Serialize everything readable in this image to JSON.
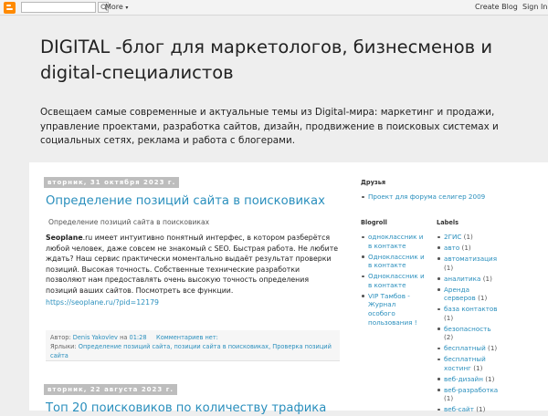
{
  "navbar": {
    "logo_icon": "blogger-icon",
    "search_value": "",
    "search_icon": "search-icon",
    "more_label": "More",
    "more_caret": "▾",
    "create_label": "Create Blog",
    "signin_label": "Sign In"
  },
  "header": {
    "title": "DIGITAL -блог для маркетологов, бизнесменов и digital-специалистов",
    "description": "Освещаем самые современные и актуальные темы из Digital-мира: маркетинг и продажи, управление проектами, разработка сайтов, дизайн, продвижение в поисковых системах и социальных сетях, реклама и работа с блогерами."
  },
  "posts": [
    {
      "date": "вторник, 31 октября 2023 г.",
      "title": "Определение позиций сайта в поисковиках",
      "subtitle": "Определение позиций сайта в поисковиках",
      "body_brand": "Seoplane",
      "body_text": ".ru имеет интуитивно понятный интерфес, в котором разберётся любой человек, даже совсем не знакомый с SEO. Быстрая работа. Не любите ждать? Наш сервис практически моментально выдаёт результат проверки позиций. Высокая точность. Собственные технические разработки позволяют нам предоставлять очень высокую точность определения позиций ваших сайтов. Посмотреть все функции.",
      "link": "https://seoplane.ru/?pid=12179",
      "author_prefix": "Автор:",
      "author": "Denis Yakovlev",
      "time_prefix": "на",
      "time": "01:28",
      "comments": "Комментариев нет:",
      "labels_prefix": "Ярлыки:",
      "labels": "Определение позиций сайта, позиции сайта в поисковиках, Проверка позиций сайта"
    },
    {
      "date": "вторник, 22 августа 2023 г.",
      "title": "Топ 20 поисковиков по количеству трафика"
    }
  ],
  "sidebar": {
    "friends": {
      "heading": "Друзья",
      "items": [
        "Проект для форума селигер 2009"
      ]
    },
    "blogroll": {
      "heading": "Blogroll",
      "items": [
        "одноклассник и в контакте",
        "Одноклассник и в контакте",
        "Одноклассник и в контакте",
        "VIP Тамбов - Журнал особого пользования !"
      ]
    },
    "labels": {
      "heading": "Labels",
      "items": [
        {
          "name": "2ГИС",
          "count": "(1)"
        },
        {
          "name": "авто",
          "count": "(1)"
        },
        {
          "name": "автоматизация",
          "count": "(1)"
        },
        {
          "name": "аналитика",
          "count": "(1)"
        },
        {
          "name": "Аренда серверов",
          "count": "(1)"
        },
        {
          "name": "база контактов",
          "count": "(1)"
        },
        {
          "name": "безопасность",
          "count": "(2)"
        },
        {
          "name": "бесплатный",
          "count": "(1)"
        },
        {
          "name": "бесплатный хостинг",
          "count": "(1)"
        },
        {
          "name": "веб-дизайн",
          "count": "(1)"
        },
        {
          "name": "веб-разработка",
          "count": "(1)"
        },
        {
          "name": "веб-сайт",
          "count": "(1)"
        }
      ]
    }
  }
}
